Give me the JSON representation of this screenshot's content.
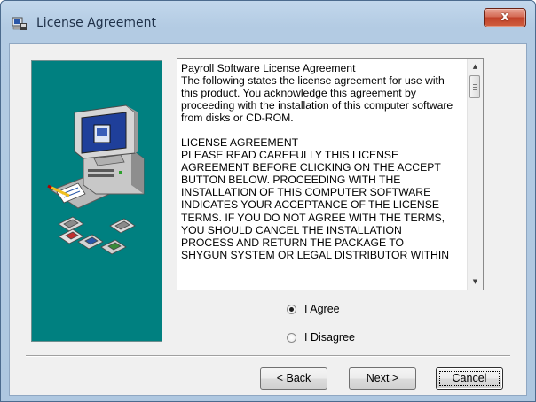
{
  "window": {
    "title": "License Agreement",
    "close_label": "x"
  },
  "license": {
    "lines": [
      "Payroll Software License Agreement",
      "The following states the license agreement for use with",
      "this product. You acknowledge this agreement by",
      "proceeding with the installation of this computer software",
      "from disks or CD-ROM.",
      "",
      "LICENSE AGREEMENT",
      "PLEASE READ CAREFULLY THIS LICENSE",
      "AGREEMENT BEFORE CLICKING ON THE ACCEPT",
      "BUTTON BELOW. PROCEEDING WITH THE",
      "INSTALLATION OF THIS COMPUTER SOFTWARE",
      "INDICATES YOUR ACCEPTANCE OF THE LICENSE",
      "TERMS. IF YOU DO NOT AGREE WITH THE TERMS,",
      "YOU SHOULD CANCEL THE INSTALLATION",
      "PROCESS AND RETURN THE PACKAGE TO",
      "SHYGUN SYSTEM OR LEGAL DISTRIBUTOR WITHIN"
    ]
  },
  "options": {
    "agree_label": "I Agree",
    "disagree_label": "I Disagree",
    "selected": "agree"
  },
  "buttons": {
    "back_label": "Back",
    "back_mnemonic": "B",
    "next_label": "Next >",
    "next_mnemonic": "N",
    "cancel_label": "Cancel"
  },
  "colors": {
    "art_background": "#008080",
    "close_button": "#c1422a"
  },
  "icons": {
    "title": "setup-icon",
    "art": "computer-with-disks-icon",
    "scroll_up": "scroll-up-arrow-icon",
    "scroll_down": "scroll-down-arrow-icon"
  }
}
